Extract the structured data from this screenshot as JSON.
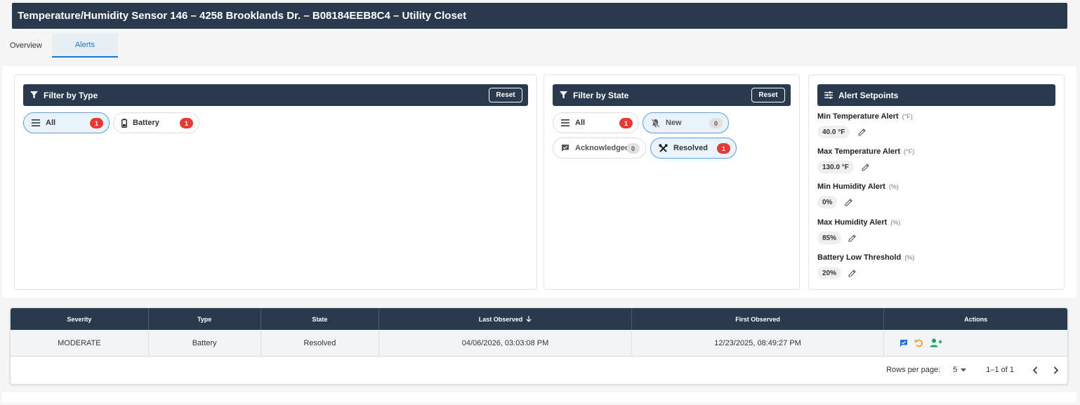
{
  "page": {
    "title": "Temperature/Humidity Sensor 146 – 4258 Brooklands Dr. – B08184EEB8C4 – Utility Closet"
  },
  "tabs": [
    {
      "label": "Overview"
    },
    {
      "label": "Alerts"
    }
  ],
  "filter_type": {
    "title": "Filter by Type",
    "reset_label": "Reset",
    "chips": [
      {
        "label": "All",
        "count": "1",
        "icon": "list-icon"
      },
      {
        "label": "Battery",
        "count": "1",
        "icon": "battery-icon"
      }
    ]
  },
  "filter_state": {
    "title": "Filter by State",
    "reset_label": "Reset",
    "chips": [
      {
        "label": "All",
        "count": "1",
        "icon": "list-icon"
      },
      {
        "label": "New",
        "count": "0",
        "icon": "bell-icon"
      },
      {
        "label": "Acknowledged",
        "count": "0",
        "icon": "comment-icon"
      },
      {
        "label": "Resolved",
        "count": "1",
        "icon": "tools-icon"
      }
    ]
  },
  "setpoints": {
    "title": "Alert Setpoints",
    "items": [
      {
        "label": "Min Temperature Alert",
        "unit": "(°F)",
        "value": "40.0 °F"
      },
      {
        "label": "Max Temperature Alert",
        "unit": "(°F)",
        "value": "130.0 °F"
      },
      {
        "label": "Min Humidity Alert",
        "unit": "(%)",
        "value": "0%"
      },
      {
        "label": "Max Humidity Alert",
        "unit": "(%)",
        "value": "85%"
      },
      {
        "label": "Battery Low Threshold",
        "unit": "(%)",
        "value": "20%"
      }
    ]
  },
  "table": {
    "columns": [
      "Severity",
      "Type",
      "State",
      "Last Observed",
      "First Observed",
      "Actions"
    ],
    "rows": [
      {
        "severity": "MODERATE",
        "type": "Battery",
        "state": "Resolved",
        "last_observed": "04/06/2026, 03:03:08 PM",
        "first_observed": "12/23/2025, 08:49:27 PM"
      }
    ],
    "pagination": {
      "rows_per_page_label": "Rows per page:",
      "rows_per_page": "5",
      "range": "1–1 of 1"
    }
  },
  "colors": {
    "header_bg": "#2a3a4e",
    "accent": "#1976d2",
    "badge_red": "#e53935",
    "action_blue": "#1976d2",
    "action_orange": "#f0a020",
    "action_green": "#22a05a"
  }
}
